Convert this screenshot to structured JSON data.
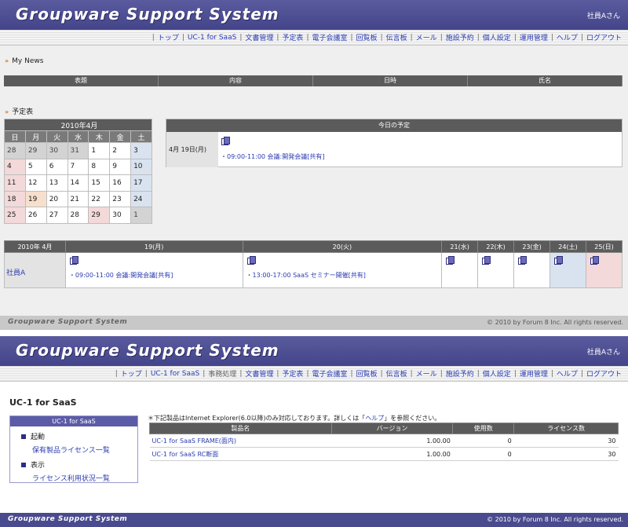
{
  "app_title": "Groupware Support System",
  "user": "社員Aさん",
  "nav": [
    "トップ",
    "UC-1 for SaaS",
    "文書管理",
    "予定表",
    "電子会議室",
    "回覧板",
    "伝言板",
    "メール",
    "施設予約",
    "個人設定",
    "運用管理",
    "ヘルプ",
    "ログアウト"
  ],
  "nav2": [
    "トップ",
    "UC-1 for SaaS",
    "事務処理",
    "文書管理",
    "予定表",
    "電子会議室",
    "回覧板",
    "伝言板",
    "メール",
    "施設予約",
    "個人設定",
    "運用管理",
    "ヘルプ",
    "ログアウト"
  ],
  "my_news": {
    "title": "My News",
    "columns": [
      "表題",
      "内容",
      "日時",
      "氏名"
    ]
  },
  "schedule_title": "予定表",
  "calendar": {
    "title": "2010年4月",
    "dow": [
      "日",
      "月",
      "火",
      "水",
      "木",
      "金",
      "土"
    ],
    "weeks": [
      [
        "28",
        "29",
        "30",
        "31",
        "1",
        "2",
        "3"
      ],
      [
        "4",
        "5",
        "6",
        "7",
        "8",
        "9",
        "10"
      ],
      [
        "11",
        "12",
        "13",
        "14",
        "15",
        "16",
        "17"
      ],
      [
        "18",
        "19",
        "20",
        "21",
        "22",
        "23",
        "24"
      ],
      [
        "25",
        "26",
        "27",
        "28",
        "29",
        "30",
        "1"
      ]
    ]
  },
  "today": {
    "title": "今日の予定",
    "date": "4月 19日(月)",
    "event": "・09:00-11:00 会議:開発会議[共有]"
  },
  "weekly": {
    "month_label": "2010年 4月",
    "days": [
      "19(月)",
      "20(火)",
      "21(水)",
      "22(木)",
      "23(金)",
      "24(土)",
      "25(日)"
    ],
    "member": "社員A",
    "events": {
      "mon": "・09:00-11:00 会議:開発会議[共有]",
      "tue": "・13:00-17:00 SaaS セミナー開催[共有]"
    }
  },
  "footer": {
    "logo": "Groupware Support System",
    "copyright": "© 2010 by Forum 8 Inc. All rights reserved."
  },
  "uc1": {
    "page_title": "UC-1 for SaaS",
    "sidebar_title": "UC-1 for SaaS",
    "sections": [
      {
        "label": "起動",
        "link": "保有製品ライセンス一覧"
      },
      {
        "label": "表示",
        "link": "ライセンス利用状況一覧"
      }
    ],
    "notice_pre": "＊下記製品はInternet Explorer(6.0以降)のみ対応しております。詳しくは「",
    "notice_link": "ヘルプ",
    "notice_post": "」を参照ください。",
    "columns": [
      "製品名",
      "バージョン",
      "使用数",
      "ライセンス数"
    ],
    "rows": [
      [
        "UC-1 for SaaS FRAME(面内)",
        "1.00.00",
        "0",
        "30"
      ],
      [
        "UC-1 for SaaS RC断面",
        "1.00.00",
        "0",
        "30"
      ]
    ]
  }
}
